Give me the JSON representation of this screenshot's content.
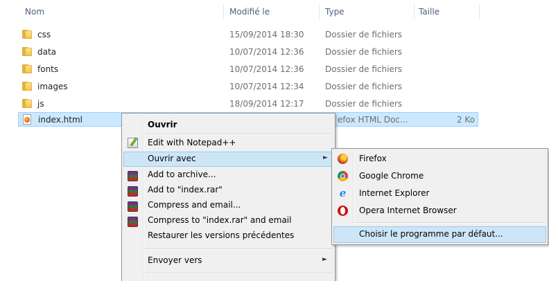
{
  "columns": {
    "name": "Nom",
    "modified": "Modifié le",
    "type": "Type",
    "size": "Taille"
  },
  "rows": [
    {
      "name": "css",
      "modified": "15/09/2014 18:30",
      "type": "Dossier de fichiers",
      "size": "",
      "icon": "folder-icon"
    },
    {
      "name": "data",
      "modified": "10/07/2014 12:36",
      "type": "Dossier de fichiers",
      "size": "",
      "icon": "folder-icon"
    },
    {
      "name": "fonts",
      "modified": "10/07/2014 12:36",
      "type": "Dossier de fichiers",
      "size": "",
      "icon": "folder-icon"
    },
    {
      "name": "images",
      "modified": "10/07/2014 12:34",
      "type": "Dossier de fichiers",
      "size": "",
      "icon": "folder-icon"
    },
    {
      "name": "js",
      "modified": "18/09/2014 12:17",
      "type": "Dossier de fichiers",
      "size": "",
      "icon": "folder-icon"
    },
    {
      "name": "index.html",
      "modified": "",
      "type": "efox HTML Doc...",
      "size": "2 Ko",
      "icon": "firefox-document-icon"
    }
  ],
  "context_menu": {
    "open": "Ouvrir",
    "edit_notepad": "Edit with Notepad++",
    "open_with": "Ouvrir avec",
    "add_archive": "Add to archive...",
    "add_rar": "Add to \"index.rar\"",
    "compress_email": "Compress and email...",
    "compress_rar_email": "Compress to \"index.rar\" and email",
    "restore": "Restaurer les versions précédentes",
    "send_to": "Envoyer vers"
  },
  "submenu": {
    "firefox": "Firefox",
    "chrome": "Google Chrome",
    "ie": "Internet Explorer",
    "opera": "Opera Internet Browser",
    "default": "Choisir le programme par défaut..."
  },
  "glyphs": {
    "arrow": "►",
    "ie": "e"
  },
  "colors": {
    "selection": "#cce8ff",
    "menu_highlight": "#cde6f7",
    "header_text": "#4c607a"
  }
}
